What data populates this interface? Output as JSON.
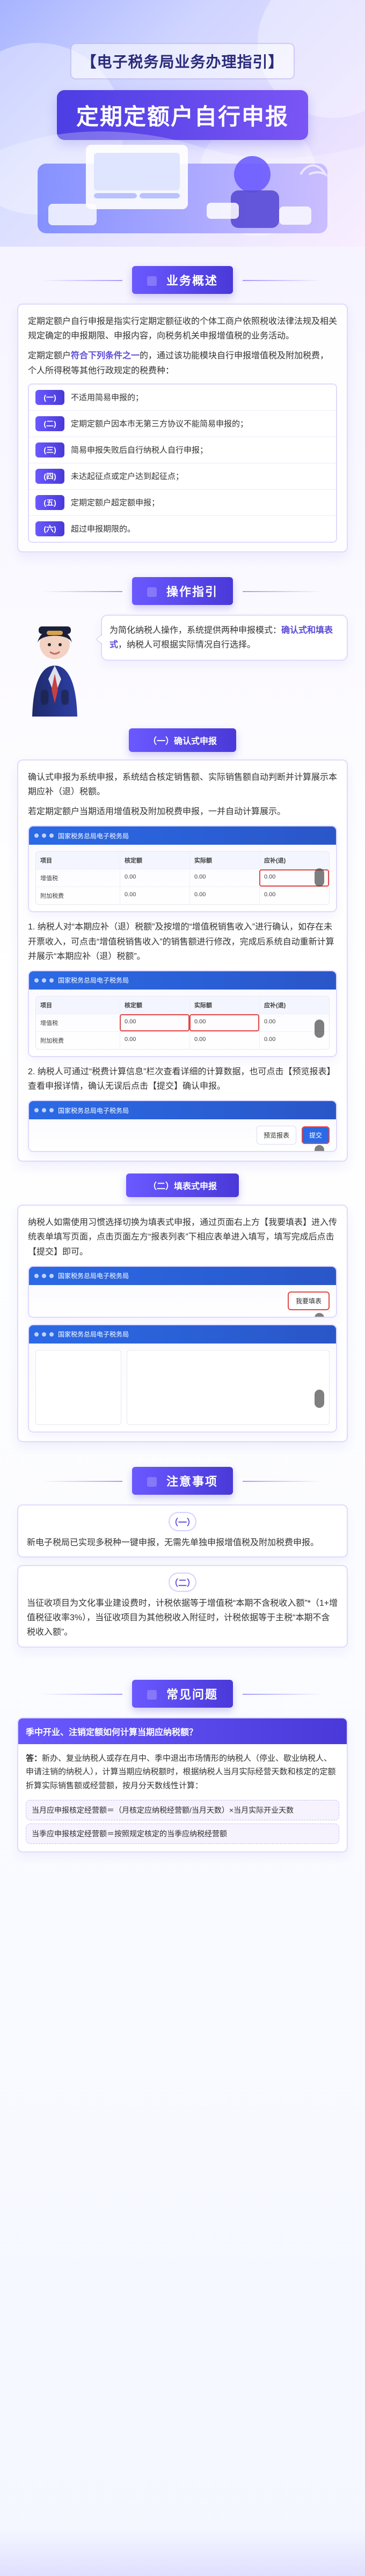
{
  "hero": {
    "subtitle": "【电子税务局业务办理指引】",
    "title": "定期定额户自行申报"
  },
  "sections": {
    "overview": {
      "label": "业务概述",
      "p1": "定期定额户自行申报是指实行定期定额征收的个体工商户依照税收法律法规及相关规定确定的申报期限、申报内容，向税务机关申报增值税的业务活动。",
      "p2_prefix": "定期定额户",
      "p2_highlight": "符合下列条件之一",
      "p2_suffix": "的，通过该功能模块自行申报增值税及附加税费，个人所得税等其他行政规定的税费种：",
      "conditions": [
        {
          "tag": "(一)",
          "text": "不适用简易申报的；"
        },
        {
          "tag": "(二)",
          "text": "定期定额户因本市无第三方协议不能简易申报的；"
        },
        {
          "tag": "(三)",
          "text": "简易申报失败后自行纳税人自行申报；"
        },
        {
          "tag": "(四)",
          "text": "未达起征点或定户达到起征点；"
        },
        {
          "tag": "(五)",
          "text": "定期定额户超定额申报；"
        },
        {
          "tag": "(六)",
          "text": "超过申报期限的。"
        }
      ]
    },
    "operation": {
      "label": "操作指引",
      "intro_prefix": "为简化纳税人操作，系统提供两种申报模式：",
      "intro_highlight": "确认式和填表式",
      "intro_suffix": "，纳税人可根据实际情况自行选择。",
      "confirm": {
        "label": "（一）确认式申报",
        "p1": "确认式申报为系统申报，系统结合核定销售额、实际销售额自动判断并计算展示本期应补（退）税额。",
        "p2": "若定期定额户当期适用增值税及附加税费申报，一并自动计算展示。",
        "step1": "1. 纳税人对“本期应补（退）税额”及按增的“增值税销售收入”进行确认，如存在未开票收入，可点击“增值税销售收入”的销售额进行修改，完成后系统自动重新计算并展示“本期应补（退）税额”。",
        "step2": "2. 纳税人可通过“税费计算信息”栏次查看详细的计算数据，也可点击【预览报表】查看申报详情，确认无误后点击【提交】确认申报。"
      },
      "form": {
        "label": "（二）填表式申报",
        "p1": "纳税人如需使用习惯选择切换为填表式申报，通过页面右上方【我要填表】进入传统表单填写页面，点击页面左方“报表列表”下相应表单进入填写，填写完成后点击【提交】即可。"
      }
    },
    "notes": {
      "label": "注意事项",
      "n1_num": "（一）",
      "n1": "新电子税局已实现多税种一键申报，无需先单独申报增值税及附加税费申报。",
      "n2_num": "（二）",
      "n2": "当征收项目为文化事业建设费时，计税依据等于增值税“本期不含税收入额”*（1+增值税征收率3%），当征收项目为其他税收入附征时，计税依据等于主税“本期不含税收入额”。"
    },
    "faq": {
      "label": "常见问题",
      "q": "季中开业、注销定额如何计算当期应纳税额？",
      "a_prefix": "答：",
      "a": "新办、复业纳税人或存在月中、季中退出市场情形的纳税人（停业、歇业纳税人、申请注销的纳税人），计算当期应纳税额时，根据纳税人当月实际经营天数和核定的定额折算实际销售额或经营额，按月分天数线性计算：",
      "formulas": [
        "当月应申报核定经营额＝（月核定应纳税经营额/当月天数）×当月实际开业天数",
        "当季应申报核定经营额＝按照规定核定的当季应纳税经营额"
      ]
    }
  },
  "ui": {
    "shot_title": "国家税务总局电子税务局",
    "table_headers": [
      "项目",
      "核定额",
      "实际额",
      "应补(退)"
    ],
    "table_rows": [
      [
        "增值税",
        "0.00",
        "0.00",
        "0.00"
      ],
      [
        "附加税费",
        "0.00",
        "0.00",
        "0.00"
      ]
    ],
    "btn_preview": "预览报表",
    "btn_submit": "提交",
    "btn_fill": "我要填表"
  }
}
